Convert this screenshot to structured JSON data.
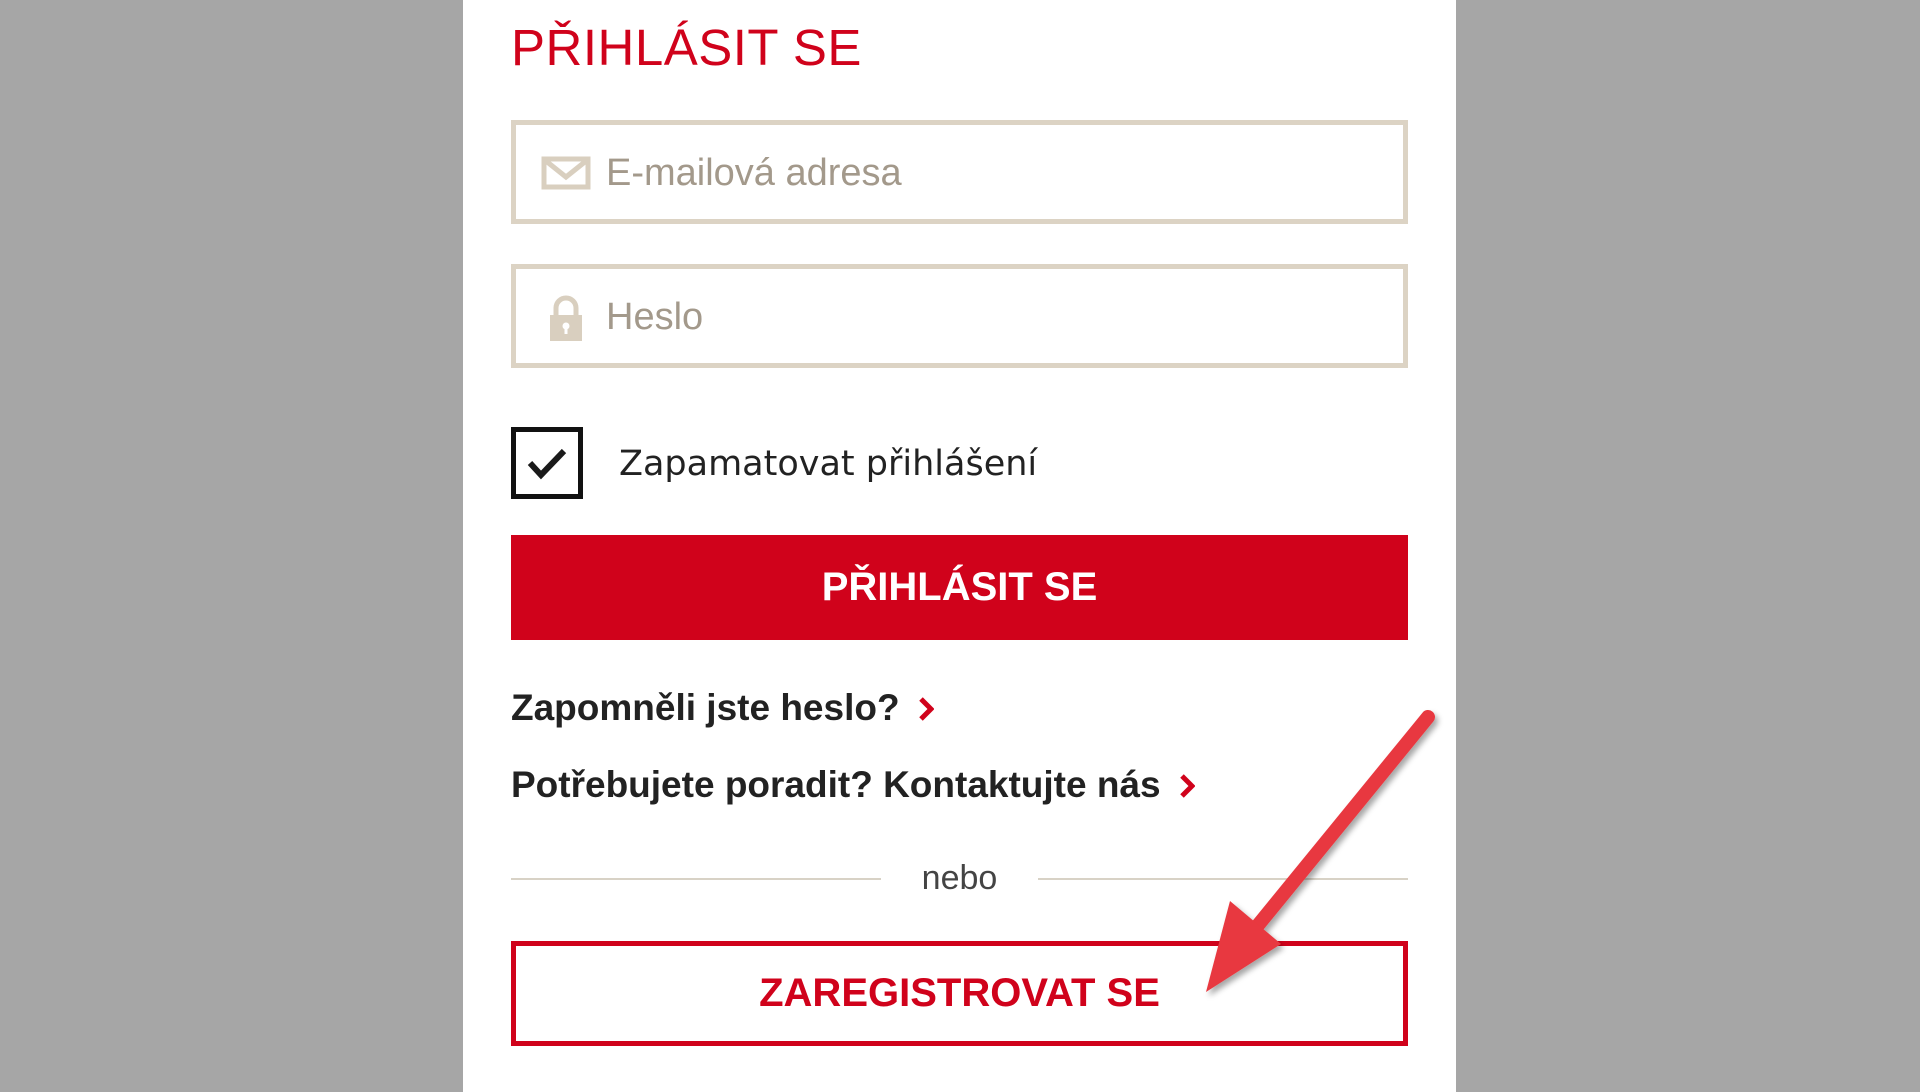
{
  "login": {
    "title": "PŘIHLÁSIT SE",
    "email_placeholder": "E-mailová adresa",
    "password_placeholder": "Heslo",
    "remember_label": "Zapamatovat přihlášení",
    "remember_checked": true,
    "submit_label": "PŘIHLÁSIT SE",
    "forgot_link": "Zapomněli jste heslo?",
    "contact_link": "Potřebujete poradit? Kontaktujte nás",
    "divider_text": "nebo",
    "register_label": "ZAREGISTROVAT SE"
  },
  "icons": [
    "envelope-icon",
    "lock-icon",
    "checkmark-icon",
    "chevron-right-icon",
    "annotation-arrow"
  ],
  "colors": {
    "accent": "#d0021b",
    "field_border": "#dcd3c4",
    "placeholder": "#a3998b",
    "backdrop": "#a6a6a6",
    "annotation_arrow": "#e8383f"
  }
}
